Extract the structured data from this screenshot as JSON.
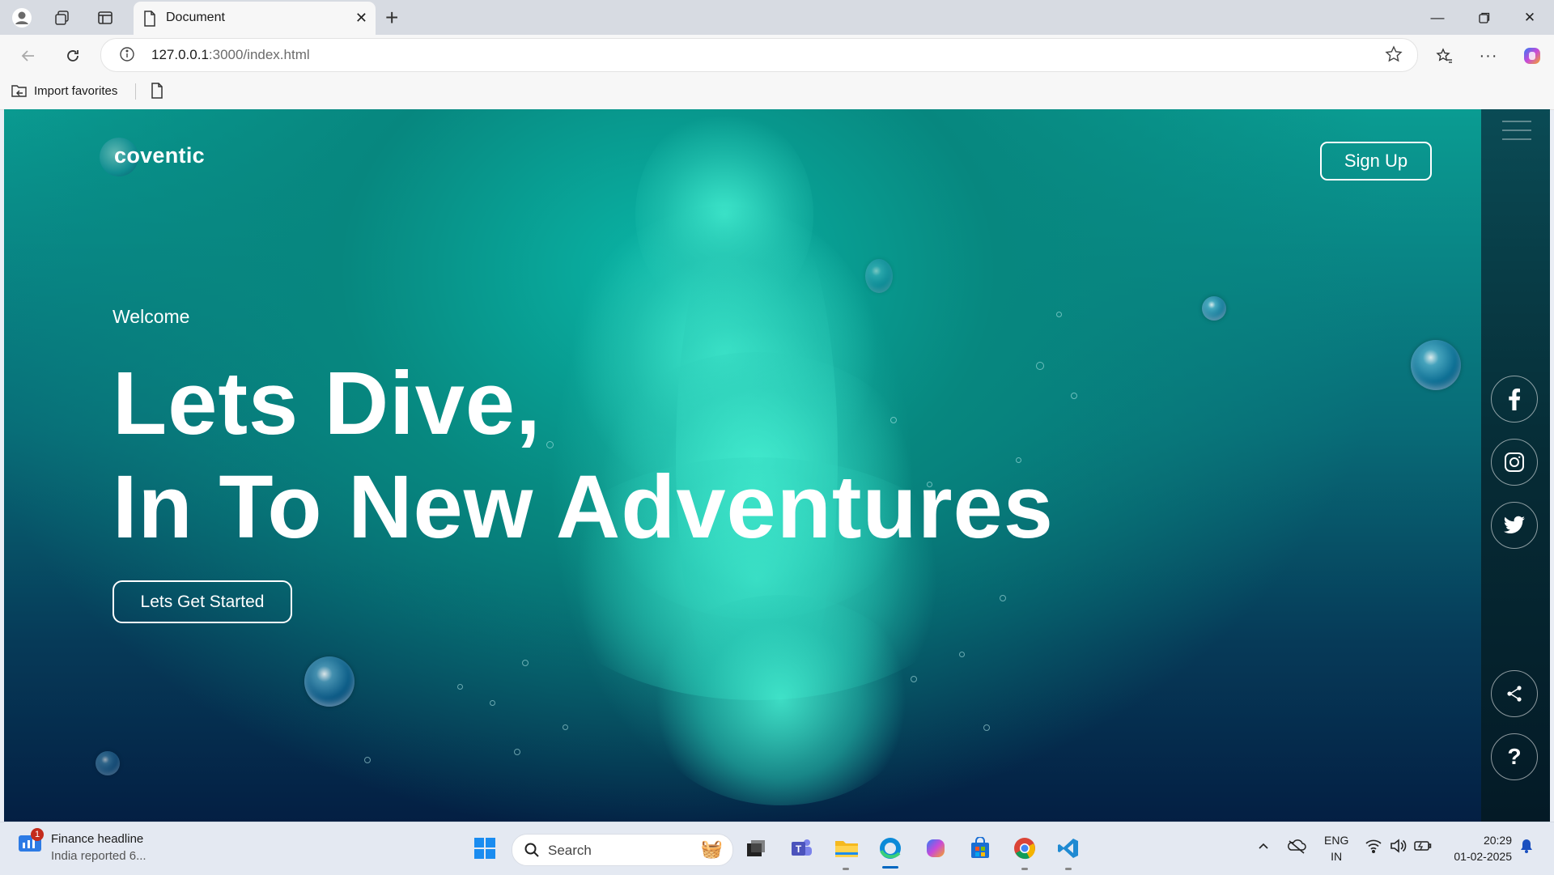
{
  "browser": {
    "tab_title": "Document",
    "url_host": "127.0.0.1",
    "url_path": ":3000/index.html",
    "favorites": {
      "import_label": "Import favorites"
    }
  },
  "page": {
    "logo_text": "coventic",
    "signup_label": "Sign Up",
    "welcome": "Welcome",
    "headline_line1": "Lets Dive,",
    "headline_line2": "In To New Adventures",
    "cta_label": "Lets Get Started",
    "social": [
      "facebook-icon",
      "instagram-icon",
      "twitter-icon"
    ],
    "utility": [
      "share-icon",
      "help-icon"
    ],
    "help_glyph": "?"
  },
  "taskbar": {
    "news_badge": "1",
    "news_title": "Finance headline",
    "news_sub": "India reported 6...",
    "search_placeholder": "Search",
    "lang_top": "ENG",
    "lang_bottom": "IN",
    "time": "20:29",
    "date": "01-02-2025"
  },
  "colors": {
    "accent_teal": "#0ab5a6",
    "deep_navy": "#041f43",
    "edge_blue": "#0067c0"
  }
}
